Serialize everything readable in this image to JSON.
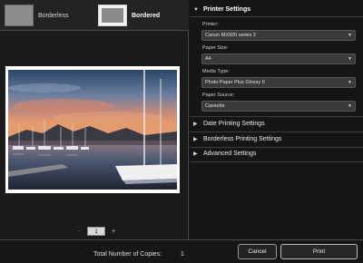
{
  "layout": {
    "borderless_label": "Borderless",
    "bordered_label": "Bordered",
    "selected": "Bordered"
  },
  "preview": {
    "page_value": "1",
    "minus_symbol": "−",
    "plus_symbol": "+"
  },
  "settings": {
    "printer_settings_title": "Printer Settings",
    "printer_label": "Printer:",
    "printer_value": "Canon MX920 series 2",
    "paper_size_label": "Paper Size:",
    "paper_size_value": "A4",
    "media_type_label": "Media Type:",
    "media_type_value": "Photo Paper Plus Glossy II",
    "paper_source_label": "Paper Source:",
    "paper_source_value": "Cassette",
    "date_printing_title": "Date Printing Settings",
    "borderless_printing_title": "Borderless Printing Settings",
    "advanced_title": "Advanced Settings",
    "expanded_icon": "triangle-down-icon",
    "collapsed_icon": "triangle-right-icon"
  },
  "footer": {
    "copies_label": "Total Number of Copies:",
    "copies_value": "1",
    "cancel_label": "Cancel",
    "print_label": "Print"
  },
  "colors": {
    "background": "#141414",
    "panel": "#1a1a1a",
    "field": "#3a3a3a",
    "divider": "#3c3c3c"
  }
}
